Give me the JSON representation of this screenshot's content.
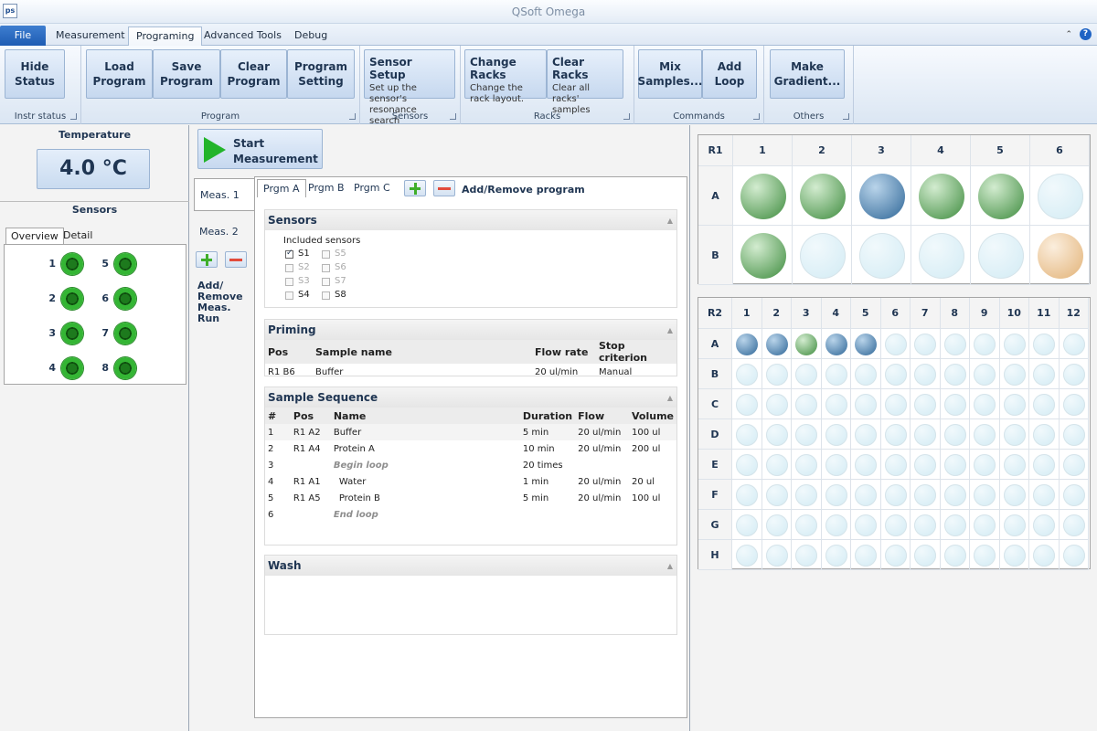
{
  "window": {
    "title": "QSoft Omega",
    "logo": "ps"
  },
  "menu": {
    "file": "File",
    "tabs": [
      "Measurement",
      "Programing",
      "Advanced Tools",
      "Debug"
    ],
    "active_tab": "Programing",
    "caret_glyph": "⌃",
    "help_glyph": "?"
  },
  "ribbon": {
    "groups": [
      {
        "label": "Instr status",
        "buttons": [
          "Hide\nStatus"
        ]
      },
      {
        "label": "Program",
        "buttons": [
          "Load\nProgram",
          "Save\nProgram",
          "Clear\nProgram",
          "Program\nSetting"
        ]
      },
      {
        "label": "Sensors",
        "buttons": [
          {
            "title": "Sensor Setup",
            "desc": "Set up the sensor's resonance search"
          }
        ]
      },
      {
        "label": "Racks",
        "buttons": [
          {
            "title": "Change Racks",
            "desc": "Change the rack layout."
          },
          {
            "title": "Clear Racks",
            "desc": "Clear all racks' samples"
          }
        ]
      },
      {
        "label": "Commands",
        "buttons": [
          "Mix\nSamples...",
          "Add\nLoop"
        ]
      },
      {
        "label": "Others",
        "buttons": [
          "Make\nGradient..."
        ]
      }
    ]
  },
  "status": {
    "temperature_heading": "Temperature",
    "temperature_value": "4.0 °C",
    "sensors_heading": "Sensors",
    "tabs": [
      "Overview",
      "Detail"
    ],
    "active_tab": "Overview",
    "sensors": [
      "1",
      "2",
      "3",
      "4",
      "5",
      "6",
      "7",
      "8"
    ],
    "sensor_color": "#2aa52a"
  },
  "measurement": {
    "start_label": "Start\nMeasurement",
    "meas_tabs": [
      "Meas. 1",
      "Meas. 2"
    ],
    "active_meas": "Meas. 1",
    "add_remove_run": "Add/\nRemove\nMeas.\nRun",
    "program_tabs": [
      "Prgm A",
      "Prgm B",
      "Prgm C"
    ],
    "active_program": "Prgm A",
    "add_remove_program": "Add/Remove program",
    "sensors_section": {
      "title": "Sensors",
      "included_label": "Included sensors",
      "sensors": [
        {
          "name": "S1",
          "checked": true,
          "enabled": true
        },
        {
          "name": "S2",
          "checked": false,
          "enabled": false
        },
        {
          "name": "S3",
          "checked": false,
          "enabled": false
        },
        {
          "name": "S4",
          "checked": false,
          "enabled": true
        },
        {
          "name": "S5",
          "checked": false,
          "enabled": false
        },
        {
          "name": "S6",
          "checked": false,
          "enabled": false
        },
        {
          "name": "S7",
          "checked": false,
          "enabled": false
        },
        {
          "name": "S8",
          "checked": false,
          "enabled": true
        }
      ]
    },
    "priming": {
      "title": "Priming",
      "columns": [
        "Pos",
        "Sample name",
        "Flow rate",
        "Stop criterion"
      ],
      "rows": [
        [
          "R1 B6",
          "Buffer",
          "20 ul/min",
          "Manual"
        ]
      ]
    },
    "sequence": {
      "title": "Sample Sequence",
      "columns": [
        "#",
        "Pos",
        "Name",
        "Duration",
        "Flow",
        "Volume"
      ],
      "rows": [
        [
          "1",
          "R1 A2",
          "Buffer",
          "5 min",
          "20 ul/min",
          "100 ul"
        ],
        [
          "2",
          "R1 A4",
          "Protein A",
          "10 min",
          "20 ul/min",
          "200 ul"
        ],
        [
          "3",
          "",
          "Begin loop",
          "20 times",
          "",
          ""
        ],
        [
          "4",
          "R1 A1",
          "  Water",
          "1 min",
          "20 ul/min",
          "20 ul"
        ],
        [
          "5",
          "R1 A5",
          "  Protein B",
          "5 min",
          "20 ul/min",
          "100 ul"
        ],
        [
          "6",
          "",
          "End loop",
          "",
          "",
          ""
        ]
      ],
      "loop_rows": [
        2,
        5
      ]
    },
    "wash": {
      "title": "Wash"
    }
  },
  "racks": {
    "r1": {
      "label": "R1",
      "cols": [
        "1",
        "2",
        "3",
        "4",
        "5",
        "6"
      ],
      "rows": [
        "A",
        "B"
      ],
      "wells": [
        [
          "green",
          "green",
          "blue",
          "green",
          "green",
          "empty"
        ],
        [
          "green",
          "empty",
          "empty",
          "empty",
          "empty",
          "orange"
        ]
      ]
    },
    "r2": {
      "label": "R2",
      "cols": [
        "1",
        "2",
        "3",
        "4",
        "5",
        "6",
        "7",
        "8",
        "9",
        "10",
        "11",
        "12"
      ],
      "rows": [
        "A",
        "B",
        "C",
        "D",
        "E",
        "F",
        "G",
        "H"
      ],
      "filled_row_a": [
        "blue",
        "blue",
        "green",
        "blue",
        "blue"
      ]
    },
    "colors": {
      "blue": "#2e6697",
      "green": "#3d8b3d",
      "orange": "#e2b277",
      "empty": "#d2ebf4"
    }
  }
}
